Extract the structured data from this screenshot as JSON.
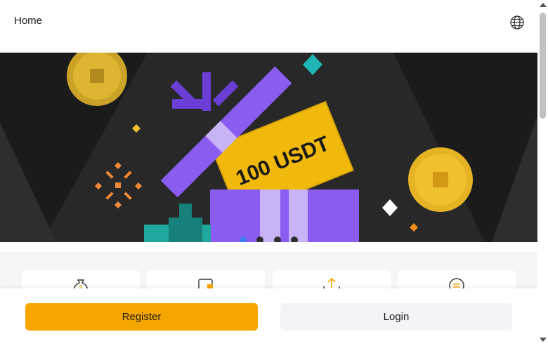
{
  "header": {
    "title": "Home",
    "language_icon": "globe-icon"
  },
  "banner": {
    "text": "100 USDT",
    "slides": 4,
    "active_slide": 1,
    "colors": {
      "background": "#1b1b1b",
      "ticket": "#f0b90b",
      "box": "#8a5cf0",
      "coin": "#e6b325"
    }
  },
  "feature_icons": [
    "money-bag-icon",
    "wallet-icon",
    "upload-icon",
    "exchange-icon"
  ],
  "actions": {
    "register_label": "Register",
    "login_label": "Login"
  },
  "colors": {
    "accent": "#f7a600",
    "secondary_button": "#f3f4f7",
    "active_dot": "#3b7bf0"
  }
}
